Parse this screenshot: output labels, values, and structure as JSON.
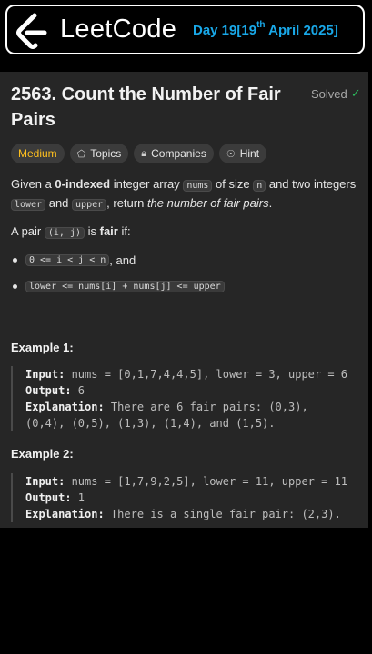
{
  "banner": {
    "brand": "LeetCode",
    "day_prefix": "Day 19[19",
    "day_sup": "th",
    "day_suffix": " April 2025]",
    "accent": "#19a8e8"
  },
  "problem": {
    "title": "2563. Count the Number of Fair Pairs",
    "solved_label": "Solved",
    "solved_icon": "check-circle-icon",
    "tags": [
      {
        "label": "Medium",
        "icon": ""
      },
      {
        "label": "Topics",
        "icon": "tag-icon"
      },
      {
        "label": "Companies",
        "icon": "lock-icon"
      },
      {
        "label": "Hint",
        "icon": "lightbulb-icon"
      }
    ],
    "desc": {
      "p1_a": "Given a ",
      "p1_b": "0-indexed",
      "p1_c": " integer array ",
      "p1_code1": "nums",
      "p1_d": " of size ",
      "p1_code2": "n",
      "p1_e": " and two integers",
      "p1_code3": "lower",
      "p1_f": " and ",
      "p1_code4": "upper",
      "p1_g": ", return ",
      "p1_h": "the number of fair pairs",
      "p1_i": ".",
      "p2_a": "A pair ",
      "p2_code": "(i, j)",
      "p2_b": " is ",
      "p2_c": "fair",
      "p2_d": " if:",
      "bullet1_code": "0 <= i < j < n",
      "bullet1_text": ", and",
      "bullet2_code": "lower <= nums[i] + nums[j] <= upper"
    },
    "examples": [
      {
        "title": "Example 1:",
        "input_label": "Input:",
        "input": " nums = [0,1,7,4,4,5], lower = 3, upper = 6",
        "output_label": "Output:",
        "output": " 6",
        "explanation_label": "Explanation:",
        "explanation_1": " There are 6 fair pairs: (0,3),",
        "explanation_2": "(0,4), (0,5), (1,3), (1,4), and (1,5)."
      },
      {
        "title": "Example 2:",
        "input_label": "Input:",
        "input": " nums = [1,7,9,2,5], lower = 11, upper = 11",
        "output_label": "Output:",
        "output": " 1",
        "explanation_label": "Explanation:",
        "explanation_1": " There is a single fair pair: (2,3)."
      }
    ],
    "colors": {
      "medium": "#ffc01e",
      "solved": "#2cbb5d"
    }
  }
}
